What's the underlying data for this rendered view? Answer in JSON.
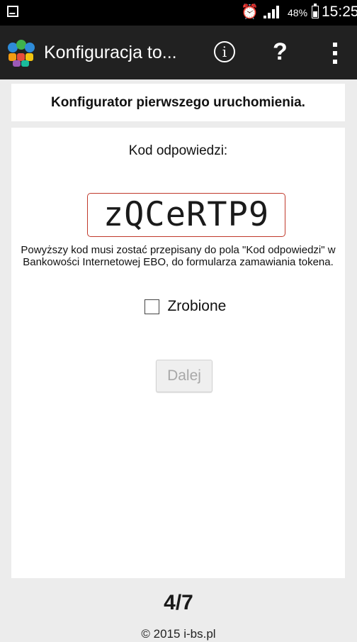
{
  "status_bar": {
    "battery": "48%",
    "battery_level": 0.48,
    "time": "15:25",
    "icons": [
      "screenshot-icon",
      "alarm-icon",
      "signal-icon",
      "battery-icon"
    ]
  },
  "app_bar": {
    "title": "Konfiguracja to...",
    "info_icon": "i",
    "help_icon": "?",
    "colors": {
      "background": "#212121",
      "text": "#ffffff"
    }
  },
  "header": {
    "title": "Konfigurator pierwszego uruchomienia."
  },
  "main": {
    "code_label": "Kod odpowiedzi:",
    "code": "zQCeRTP9",
    "description": "Powyższy kod musi zostać przepisany do pola \"Kod odpowiedzi\" w Bankowości Internetowej EBO, do formularza zamawiania tokena.",
    "done_checkbox": {
      "label": "Zrobione",
      "checked": false
    },
    "next_button": {
      "label": "Dalej",
      "enabled": false
    },
    "colors": {
      "code_border": "#c0392b"
    }
  },
  "footer": {
    "step": "4/7",
    "copyright": "© 2015 i-bs.pl"
  }
}
